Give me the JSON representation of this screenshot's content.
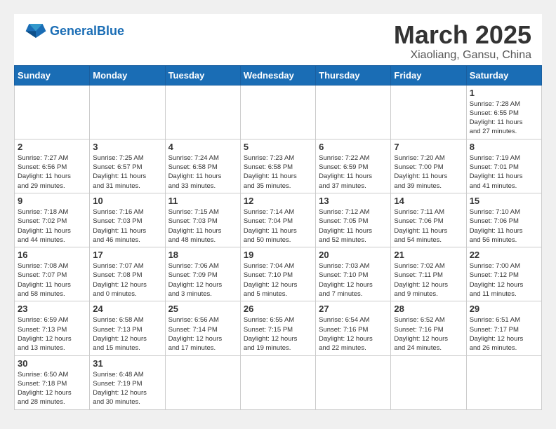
{
  "header": {
    "logo_general": "General",
    "logo_blue": "Blue",
    "month_title": "March 2025",
    "subtitle": "Xiaoliang, Gansu, China"
  },
  "weekdays": [
    "Sunday",
    "Monday",
    "Tuesday",
    "Wednesday",
    "Thursday",
    "Friday",
    "Saturday"
  ],
  "weeks": [
    [
      {
        "day": "",
        "info": ""
      },
      {
        "day": "",
        "info": ""
      },
      {
        "day": "",
        "info": ""
      },
      {
        "day": "",
        "info": ""
      },
      {
        "day": "",
        "info": ""
      },
      {
        "day": "",
        "info": ""
      },
      {
        "day": "1",
        "info": "Sunrise: 7:28 AM\nSunset: 6:55 PM\nDaylight: 11 hours\nand 27 minutes."
      }
    ],
    [
      {
        "day": "2",
        "info": "Sunrise: 7:27 AM\nSunset: 6:56 PM\nDaylight: 11 hours\nand 29 minutes."
      },
      {
        "day": "3",
        "info": "Sunrise: 7:25 AM\nSunset: 6:57 PM\nDaylight: 11 hours\nand 31 minutes."
      },
      {
        "day": "4",
        "info": "Sunrise: 7:24 AM\nSunset: 6:58 PM\nDaylight: 11 hours\nand 33 minutes."
      },
      {
        "day": "5",
        "info": "Sunrise: 7:23 AM\nSunset: 6:58 PM\nDaylight: 11 hours\nand 35 minutes."
      },
      {
        "day": "6",
        "info": "Sunrise: 7:22 AM\nSunset: 6:59 PM\nDaylight: 11 hours\nand 37 minutes."
      },
      {
        "day": "7",
        "info": "Sunrise: 7:20 AM\nSunset: 7:00 PM\nDaylight: 11 hours\nand 39 minutes."
      },
      {
        "day": "8",
        "info": "Sunrise: 7:19 AM\nSunset: 7:01 PM\nDaylight: 11 hours\nand 41 minutes."
      }
    ],
    [
      {
        "day": "9",
        "info": "Sunrise: 7:18 AM\nSunset: 7:02 PM\nDaylight: 11 hours\nand 44 minutes."
      },
      {
        "day": "10",
        "info": "Sunrise: 7:16 AM\nSunset: 7:03 PM\nDaylight: 11 hours\nand 46 minutes."
      },
      {
        "day": "11",
        "info": "Sunrise: 7:15 AM\nSunset: 7:03 PM\nDaylight: 11 hours\nand 48 minutes."
      },
      {
        "day": "12",
        "info": "Sunrise: 7:14 AM\nSunset: 7:04 PM\nDaylight: 11 hours\nand 50 minutes."
      },
      {
        "day": "13",
        "info": "Sunrise: 7:12 AM\nSunset: 7:05 PM\nDaylight: 11 hours\nand 52 minutes."
      },
      {
        "day": "14",
        "info": "Sunrise: 7:11 AM\nSunset: 7:06 PM\nDaylight: 11 hours\nand 54 minutes."
      },
      {
        "day": "15",
        "info": "Sunrise: 7:10 AM\nSunset: 7:06 PM\nDaylight: 11 hours\nand 56 minutes."
      }
    ],
    [
      {
        "day": "16",
        "info": "Sunrise: 7:08 AM\nSunset: 7:07 PM\nDaylight: 11 hours\nand 58 minutes."
      },
      {
        "day": "17",
        "info": "Sunrise: 7:07 AM\nSunset: 7:08 PM\nDaylight: 12 hours\nand 0 minutes."
      },
      {
        "day": "18",
        "info": "Sunrise: 7:06 AM\nSunset: 7:09 PM\nDaylight: 12 hours\nand 3 minutes."
      },
      {
        "day": "19",
        "info": "Sunrise: 7:04 AM\nSunset: 7:10 PM\nDaylight: 12 hours\nand 5 minutes."
      },
      {
        "day": "20",
        "info": "Sunrise: 7:03 AM\nSunset: 7:10 PM\nDaylight: 12 hours\nand 7 minutes."
      },
      {
        "day": "21",
        "info": "Sunrise: 7:02 AM\nSunset: 7:11 PM\nDaylight: 12 hours\nand 9 minutes."
      },
      {
        "day": "22",
        "info": "Sunrise: 7:00 AM\nSunset: 7:12 PM\nDaylight: 12 hours\nand 11 minutes."
      }
    ],
    [
      {
        "day": "23",
        "info": "Sunrise: 6:59 AM\nSunset: 7:13 PM\nDaylight: 12 hours\nand 13 minutes."
      },
      {
        "day": "24",
        "info": "Sunrise: 6:58 AM\nSunset: 7:13 PM\nDaylight: 12 hours\nand 15 minutes."
      },
      {
        "day": "25",
        "info": "Sunrise: 6:56 AM\nSunset: 7:14 PM\nDaylight: 12 hours\nand 17 minutes."
      },
      {
        "day": "26",
        "info": "Sunrise: 6:55 AM\nSunset: 7:15 PM\nDaylight: 12 hours\nand 19 minutes."
      },
      {
        "day": "27",
        "info": "Sunrise: 6:54 AM\nSunset: 7:16 PM\nDaylight: 12 hours\nand 22 minutes."
      },
      {
        "day": "28",
        "info": "Sunrise: 6:52 AM\nSunset: 7:16 PM\nDaylight: 12 hours\nand 24 minutes."
      },
      {
        "day": "29",
        "info": "Sunrise: 6:51 AM\nSunset: 7:17 PM\nDaylight: 12 hours\nand 26 minutes."
      }
    ],
    [
      {
        "day": "30",
        "info": "Sunrise: 6:50 AM\nSunset: 7:18 PM\nDaylight: 12 hours\nand 28 minutes."
      },
      {
        "day": "31",
        "info": "Sunrise: 6:48 AM\nSunset: 7:19 PM\nDaylight: 12 hours\nand 30 minutes."
      },
      {
        "day": "",
        "info": ""
      },
      {
        "day": "",
        "info": ""
      },
      {
        "day": "",
        "info": ""
      },
      {
        "day": "",
        "info": ""
      },
      {
        "day": "",
        "info": ""
      }
    ]
  ]
}
